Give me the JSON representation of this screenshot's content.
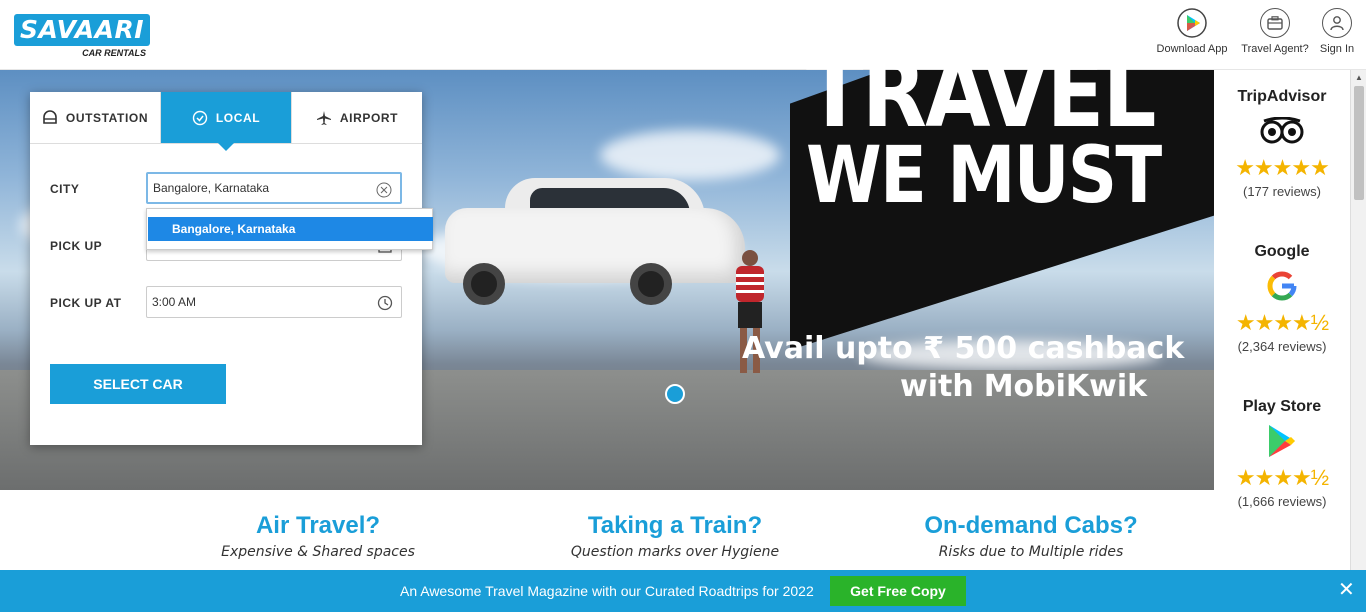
{
  "header": {
    "logo_main": "SAVAARI",
    "logo_sub": "CAR RENTALS",
    "links": [
      {
        "label": "Download App",
        "icon": "play-store-icon"
      },
      {
        "label": "Travel Agent?",
        "icon": "briefcase-icon"
      },
      {
        "label": "Sign In",
        "icon": "user-icon"
      }
    ]
  },
  "booking": {
    "tabs": [
      {
        "label": "OUTSTATION",
        "icon": "outstation-icon",
        "active": false
      },
      {
        "label": "LOCAL",
        "icon": "location-pin-icon",
        "active": true
      },
      {
        "label": "AIRPORT",
        "icon": "airplane-icon",
        "active": false
      }
    ],
    "city_label": "CITY",
    "city_value": "Bangalore, Karnataka",
    "pickup_label": "PICK UP",
    "pickup_time_label": "PICK UP AT",
    "pickup_time_value": "3:00 AM",
    "select_button": "SELECT CAR",
    "dropdown_option": "Bangalore, Karnataka"
  },
  "banner": {
    "headline_line1": "TRAVEL",
    "headline_line2": "WE MUST",
    "promo_line1": "Avail upto ₹ 500 cashback",
    "promo_with": "with",
    "promo_brand": "MobiKwik"
  },
  "reviews": [
    {
      "name": "TripAdvisor",
      "icon": "tripadvisor-owl-icon",
      "stars": "★★★★★",
      "count": "(177 reviews)"
    },
    {
      "name": "Google",
      "icon": "google-g-icon",
      "stars": "★★★★½",
      "count": "(2,364 reviews)"
    },
    {
      "name": "Play Store",
      "icon": "play-store-icon",
      "stars": "★★★★½",
      "count": "(1,666 reviews)"
    }
  ],
  "features": [
    {
      "title": "Air Travel?",
      "subtitle": "Expensive & Shared spaces"
    },
    {
      "title": "Taking a Train?",
      "subtitle": "Question marks over Hygiene"
    },
    {
      "title": "On-demand Cabs?",
      "subtitle": "Risks due to Multiple rides"
    }
  ],
  "bottom_bar": {
    "text": "An Awesome Travel Magazine with our Curated Roadtrips for 2022",
    "button": "Get Free Copy",
    "close": "✕"
  },
  "colors": {
    "brand": "#1a9ed8",
    "cta_green": "#2ab32a",
    "star": "#f4b400"
  }
}
